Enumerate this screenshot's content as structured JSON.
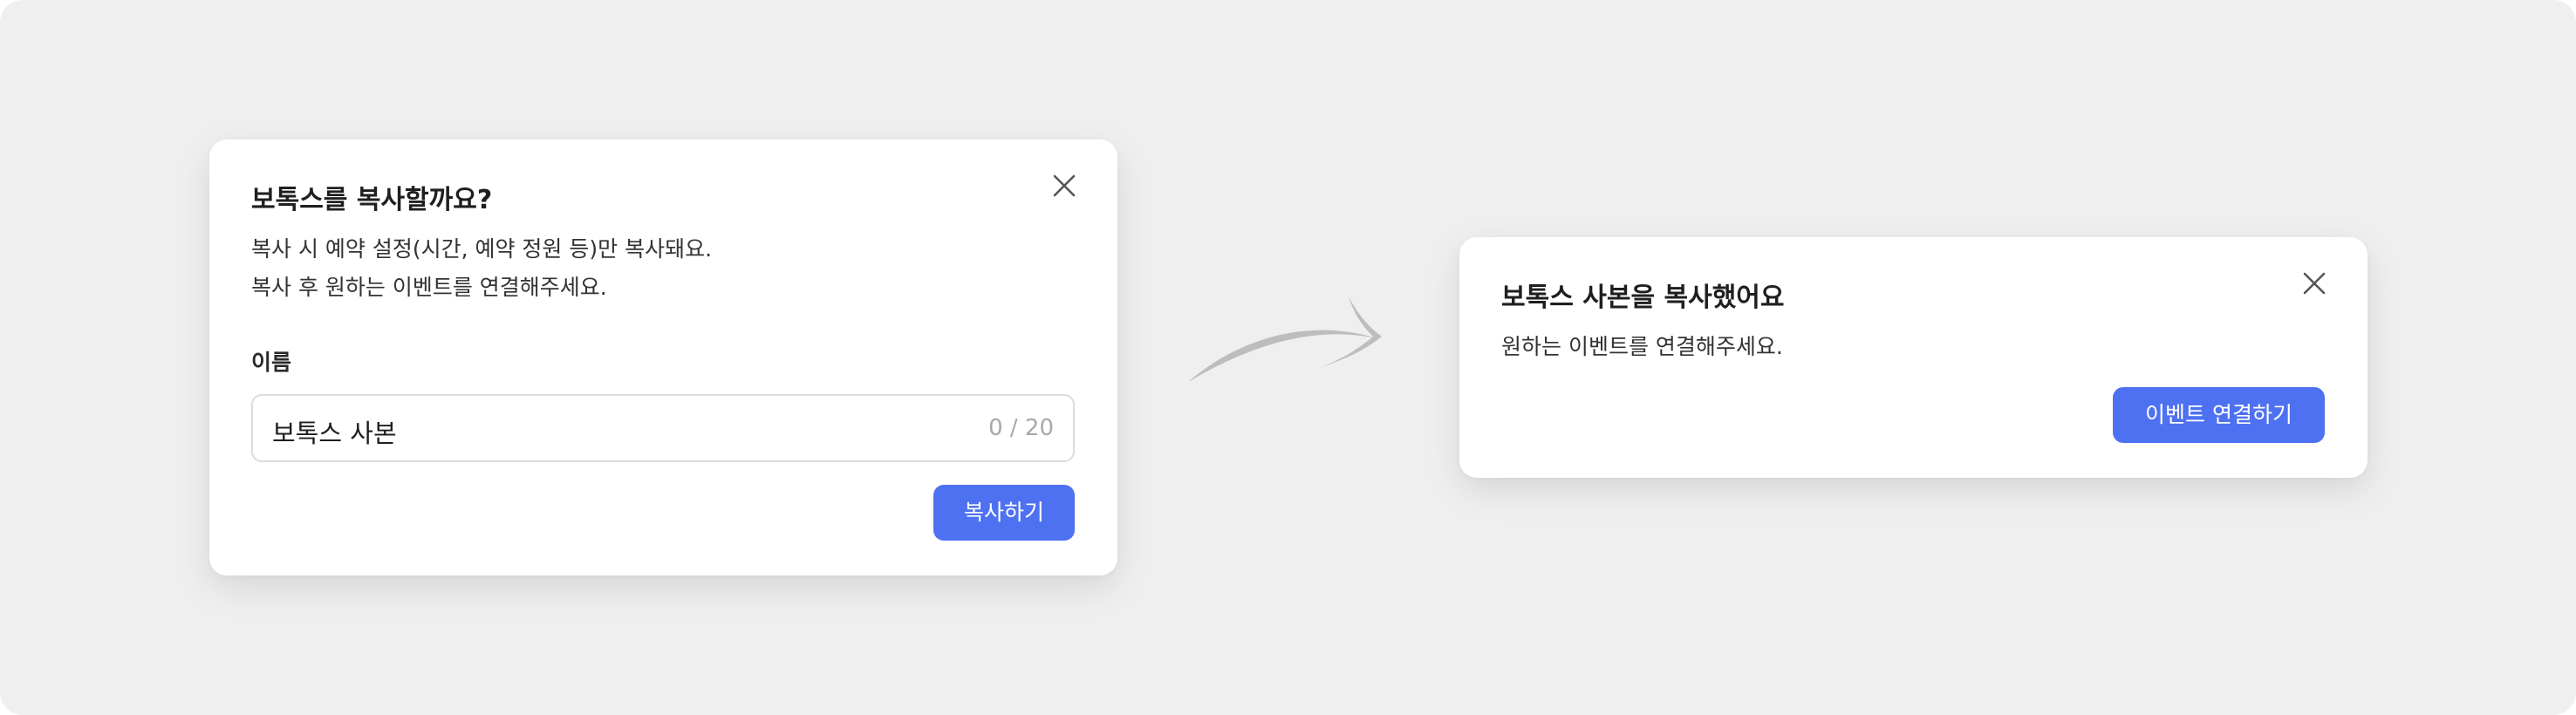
{
  "copy_dialog": {
    "title": "보톡스를 복사할까요?",
    "description_line1": "복사 시 예약 설정(시간, 예약 정원 등)만 복사돼요.",
    "description_line2": "복사 후 원하는 이벤트를 연결해주세요.",
    "name_label": "이름",
    "name_value": "보톡스 사본",
    "name_counter": "0 / 20",
    "copy_button_label": "복사하기"
  },
  "done_dialog": {
    "title": "보톡스 사본을 복사했어요",
    "description": "원하는 이벤트를 연결해주세요.",
    "connect_button_label": "이벤트 연결하기"
  },
  "colors": {
    "primary": "#4e71f2",
    "background": "#efefef",
    "arrow": "#bdbdbd"
  },
  "icons": {
    "close": "close-icon",
    "transition": "curved-arrow-icon"
  }
}
